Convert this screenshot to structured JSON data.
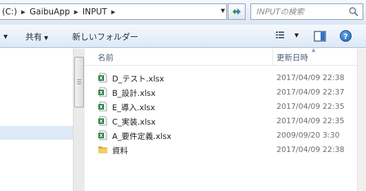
{
  "address_bar": {
    "crumbs": [
      "(C:)",
      "GaibuApp",
      "INPUT"
    ]
  },
  "search": {
    "placeholder": "INPUTの検索"
  },
  "toolbar": {
    "share_label": "共有",
    "new_folder_label": "新しいフォルダー"
  },
  "columns": {
    "name": "名前",
    "date_modified": "更新日時"
  },
  "files": [
    {
      "name": "D_テスト.xlsx",
      "date": "2017/04/09 22:38",
      "icon": "excel-file-icon"
    },
    {
      "name": "B_設計.xlsx",
      "date": "2017/04/09 22:37",
      "icon": "excel-file-icon"
    },
    {
      "name": "E_導入.xlsx",
      "date": "2017/04/09 22:35",
      "icon": "excel-file-icon"
    },
    {
      "name": "C_実装.xlsx",
      "date": "2017/04/09 22:35",
      "icon": "excel-file-icon"
    },
    {
      "name": "A_要件定義.xlsx",
      "date": "2009/09/20 3:30",
      "icon": "excel-file-icon"
    },
    {
      "name": "資料",
      "date": "2017/04/09 22:38",
      "icon": "folder-icon"
    }
  ],
  "colors": {
    "toolbar_bg": "#dde8f5",
    "nav_selected": "#dde9f7",
    "excel_green": "#1f7a3a",
    "folder_yellow": "#e8c45a"
  }
}
